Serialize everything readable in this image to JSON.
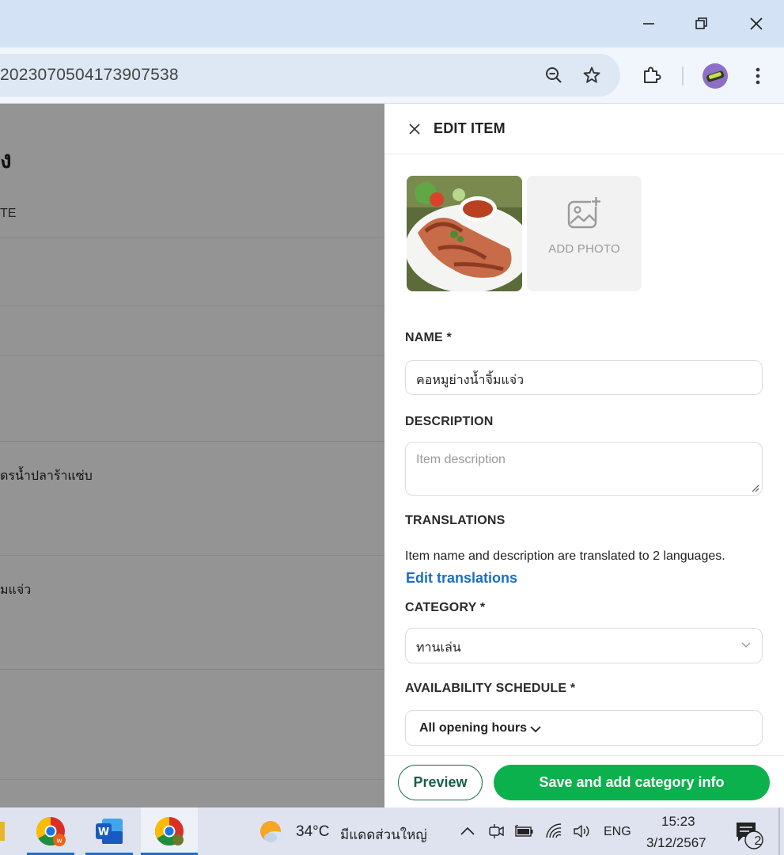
{
  "browser": {
    "url": "202307050417390753​8",
    "minimize_icon": "minimize-icon",
    "restore_icon": "restore-icon",
    "close_icon": "close-icon"
  },
  "background_page": {
    "heading": "ง",
    "column_header": "TE",
    "rows": [
      "ดรน้ำปลาร้าแซ่บ",
      "มแจ่ว"
    ]
  },
  "panel": {
    "title": "EDIT ITEM",
    "add_photo_label": "ADD PHOTO",
    "name_label": "NAME *",
    "name_value": "คอหมูย่างน้ำจิ้มแจ่ว",
    "description_label": "DESCRIPTION",
    "description_placeholder": "Item description",
    "translations_label": "TRANSLATIONS",
    "translations_text": "Item name and description are translated to 2 languages.",
    "edit_translations_link": "Edit translations",
    "category_label": "CATEGORY *",
    "category_value": "ทานเล่น",
    "availability_label": "AVAILABILITY SCHEDULE *",
    "availability_value": "All opening hours",
    "preview_button": "Preview",
    "save_button": "Save and add category info"
  },
  "taskbar": {
    "weather_temp": "34°C",
    "weather_desc": "มีแดดส่วนใหญ่",
    "language": "ENG",
    "time": "15:23",
    "date": "3/12/2567",
    "notification_count": "2"
  },
  "colors": {
    "accent_green": "#0bb14c",
    "link_blue": "#1a6fc0",
    "titlebar": "#d3e3f5"
  }
}
